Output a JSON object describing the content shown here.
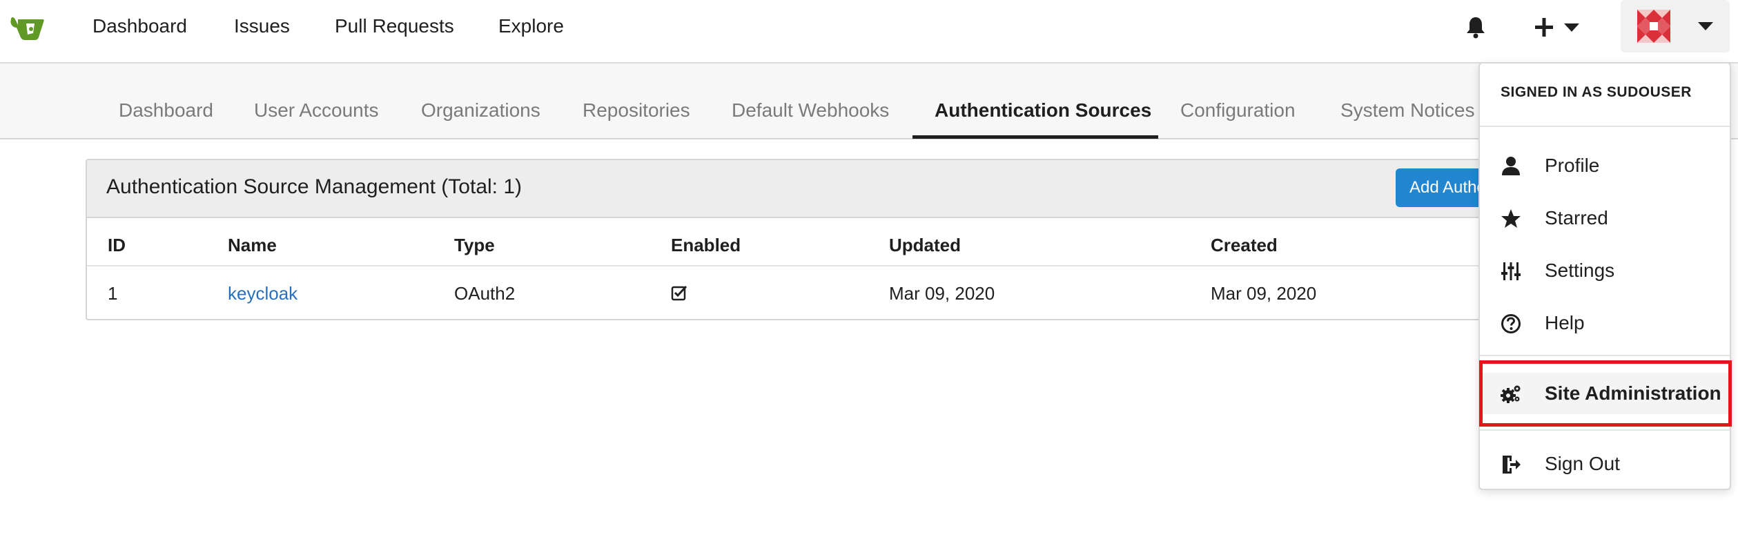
{
  "navbar": {
    "logo_icon": "gitea-teacup-logo-icon",
    "items": [
      {
        "label": "Dashboard"
      },
      {
        "label": "Issues"
      },
      {
        "label": "Pull Requests"
      },
      {
        "label": "Explore"
      }
    ],
    "notification_icon": "bell-icon",
    "create_icon": "plus-icon",
    "avatar_icon": "user-avatar-identicon"
  },
  "admin_tabs": [
    {
      "label": "Dashboard",
      "active": false
    },
    {
      "label": "User Accounts",
      "active": false
    },
    {
      "label": "Organizations",
      "active": false
    },
    {
      "label": "Repositories",
      "active": false
    },
    {
      "label": "Default Webhooks",
      "active": false
    },
    {
      "label": "Authentication Sources",
      "active": true
    },
    {
      "label": "Configuration",
      "active": false
    },
    {
      "label": "System Notices",
      "active": false
    }
  ],
  "auth_sources": {
    "title": "Authentication Source Management (Total: 1)",
    "add_button": "Add Authentication Source",
    "columns": [
      "ID",
      "Name",
      "Type",
      "Enabled",
      "Updated",
      "Created"
    ],
    "rows": [
      {
        "id": "1",
        "name": "keycloak",
        "type": "OAuth2",
        "enabled": true,
        "updated": "Mar 09, 2020",
        "created": "Mar 09, 2020"
      }
    ]
  },
  "user_menu": {
    "header": "SIGNED IN AS SUDOUSER",
    "items": [
      {
        "label": "Profile",
        "icon": "person-icon"
      },
      {
        "label": "Starred",
        "icon": "star-icon"
      },
      {
        "label": "Settings",
        "icon": "sliders-icon"
      },
      {
        "label": "Help",
        "icon": "question-circle-icon"
      },
      {
        "label": "Site Administration",
        "icon": "gears-icon"
      },
      {
        "label": "Sign Out",
        "icon": "sign-out-icon"
      }
    ]
  },
  "colors": {
    "primary_button": "#2185d0",
    "link": "#2a6fba",
    "highlight_border": "#e8141b",
    "logo_green": "#609926"
  }
}
